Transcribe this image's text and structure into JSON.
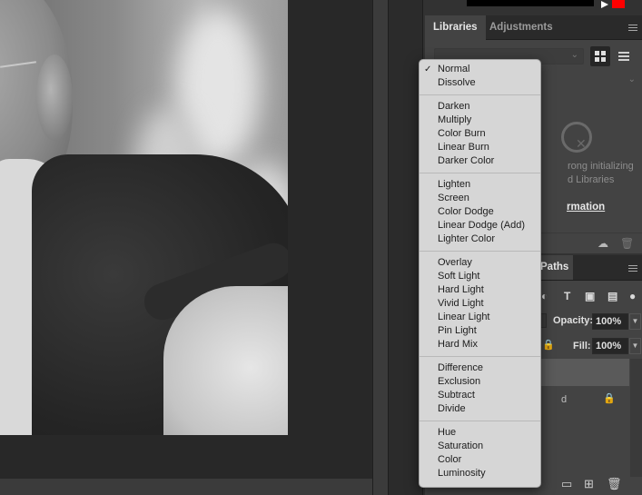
{
  "libraries_panel": {
    "tabs": [
      "Libraries",
      "Adjustments"
    ],
    "active_tab": "Libraries",
    "error_message": "rong initializing\nd Libraries",
    "link_text": "rmation"
  },
  "layers_panel": {
    "visible_tab": "Paths",
    "opacity_label": "Opacity:",
    "opacity_value": "100%",
    "fill_label": "Fill:",
    "fill_value": "100%",
    "layer2_partial": "d"
  },
  "blend_menu": {
    "selected": "Normal",
    "groups": [
      [
        "Normal",
        "Dissolve"
      ],
      [
        "Darken",
        "Multiply",
        "Color Burn",
        "Linear Burn",
        "Darker Color"
      ],
      [
        "Lighten",
        "Screen",
        "Color Dodge",
        "Linear Dodge (Add)",
        "Lighter Color"
      ],
      [
        "Overlay",
        "Soft Light",
        "Hard Light",
        "Vivid Light",
        "Linear Light",
        "Pin Light",
        "Hard Mix"
      ],
      [
        "Difference",
        "Exclusion",
        "Subtract",
        "Divide"
      ],
      [
        "Hue",
        "Saturation",
        "Color",
        "Luminosity"
      ]
    ]
  },
  "colors": {
    "foreground": "#000000",
    "accent": "#ff0000",
    "menu_bg": "#d6d6d6"
  },
  "icons": [
    "menu-icon",
    "grid-view-icon",
    "list-view-icon",
    "library-error-icon",
    "cloud-sync-icon",
    "trash-icon",
    "check-icon"
  ]
}
